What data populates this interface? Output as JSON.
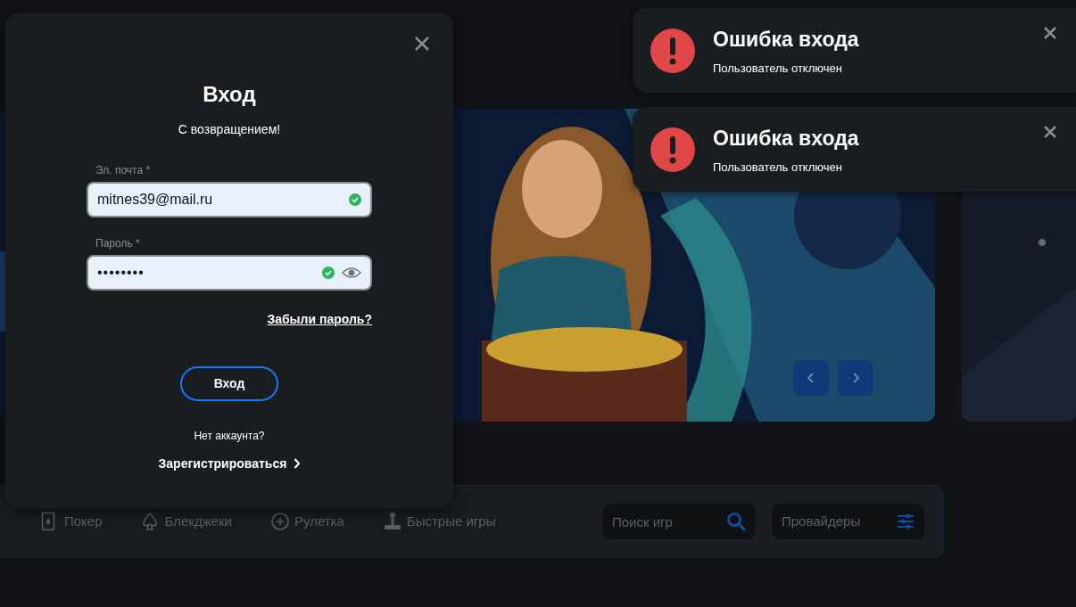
{
  "modal": {
    "title": "Вход",
    "subtitle": "С возвращением!",
    "fields": [
      {
        "kind": "email",
        "label": "Эл. почта *",
        "value": "mitnes39@mail.ru",
        "valid": true
      },
      {
        "kind": "password",
        "label": "Пароль *",
        "value": "••••••••",
        "valid": true
      }
    ],
    "forgot_link": "Забыли пароль?",
    "submit": "Вход",
    "no_account": "Нет аккаунта?",
    "register_link": "Зарегистрироваться"
  },
  "toasts": [
    {
      "title": "Ошибка входа",
      "message": "Пользователь отключен"
    },
    {
      "title": "Ошибка входа",
      "message": "Пользователь отключен"
    }
  ],
  "categories": [
    {
      "label": "Покер"
    },
    {
      "label": "Блекджеки"
    },
    {
      "label": "Рулетка"
    },
    {
      "label": "Быстрые игры"
    }
  ],
  "search": {
    "placeholder": "Поиск игр"
  },
  "providers": {
    "label": "Провайдеры"
  }
}
